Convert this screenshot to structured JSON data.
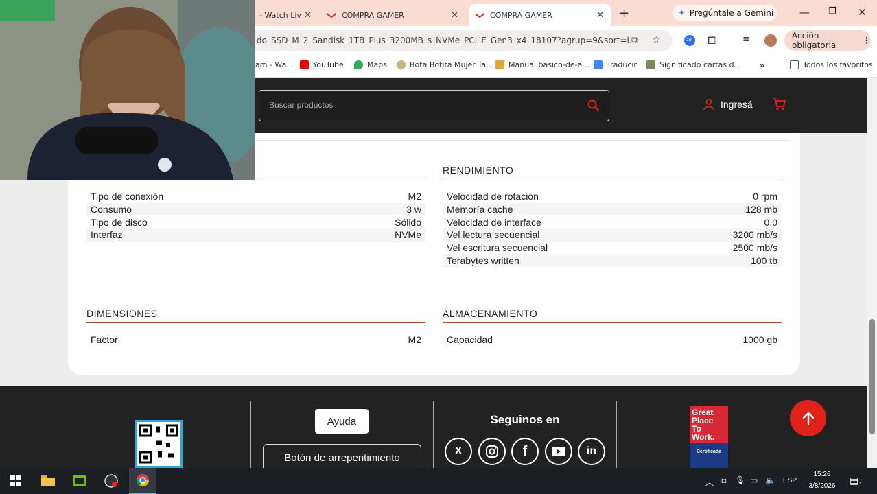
{
  "browser": {
    "tabs": [
      {
        "label": "- Watch Liv"
      },
      {
        "label": "COMPRA GAMER"
      },
      {
        "label": "COMPRA GAMER"
      }
    ],
    "gemini_label": "Pregúntale a Gemini",
    "url": "do_SSD_M_2_Sandisk_1TB_Plus_3200MB_s_NVMe_PCI_E_Gen3_x4_18107?agrup=9&sort=l...",
    "action_label": "Acción obligatoria",
    "bookmarks": [
      "am - Wa...",
      "YouTube",
      "Maps",
      "Bota Botita Mujer Ta...",
      "Manual basico-de-a...",
      "Traducir",
      "Significado cartas d..."
    ],
    "all_favorites": "Todos los favoritos",
    "colors": {
      "tabstrip": "#f9dcd2",
      "accent_red": "#e0221a"
    }
  },
  "site": {
    "search_placeholder": "Buscar productos",
    "login_label": "Ingresá",
    "icons": {
      "search": "search-icon",
      "user": "user-icon",
      "cart": "cart-icon"
    }
  },
  "specs": {
    "general": {
      "rows": [
        {
          "label": "Tipo de conexión",
          "value": "M2"
        },
        {
          "label": "Consumo",
          "value": "3 w"
        },
        {
          "label": "Tipo de disco",
          "value": "Sólido"
        },
        {
          "label": "Interfaz",
          "value": "NVMe"
        }
      ]
    },
    "rendimiento": {
      "title": "RENDIMIENTO",
      "rows": [
        {
          "label": "Velocidad de rotación",
          "value": "0 rpm"
        },
        {
          "label": "Memoría cache",
          "value": "128 mb"
        },
        {
          "label": "Velocidad de interface",
          "value": "0.0"
        },
        {
          "label": "Vel lectura secuencial",
          "value": "3200 mb/s"
        },
        {
          "label": "Vel escritura secuencial",
          "value": "2500 mb/s"
        },
        {
          "label": "Terabytes written",
          "value": "100 tb"
        }
      ]
    },
    "dimensiones": {
      "title": "DIMENSIONES",
      "rows": [
        {
          "label": "Factor",
          "value": "M2"
        }
      ]
    },
    "almacenamiento": {
      "title": "ALMACENAMIENTO",
      "rows": [
        {
          "label": "Capacidad",
          "value": "1000 gb"
        }
      ]
    }
  },
  "footer": {
    "help_label": "Ayuda",
    "regret_label": "Botón de arrepentimiento",
    "follow_label": "Seguinos en",
    "social": [
      "X",
      "Instagram",
      "f",
      "YouTube",
      "in"
    ],
    "gptw": {
      "line1": "Great",
      "line2": "Place",
      "line3": "To",
      "line4": "Work.",
      "cert": "Certificada"
    }
  },
  "taskbar": {
    "language": "ESP",
    "time": "15:26",
    "date": "3/8/2026",
    "notifications": "1"
  }
}
